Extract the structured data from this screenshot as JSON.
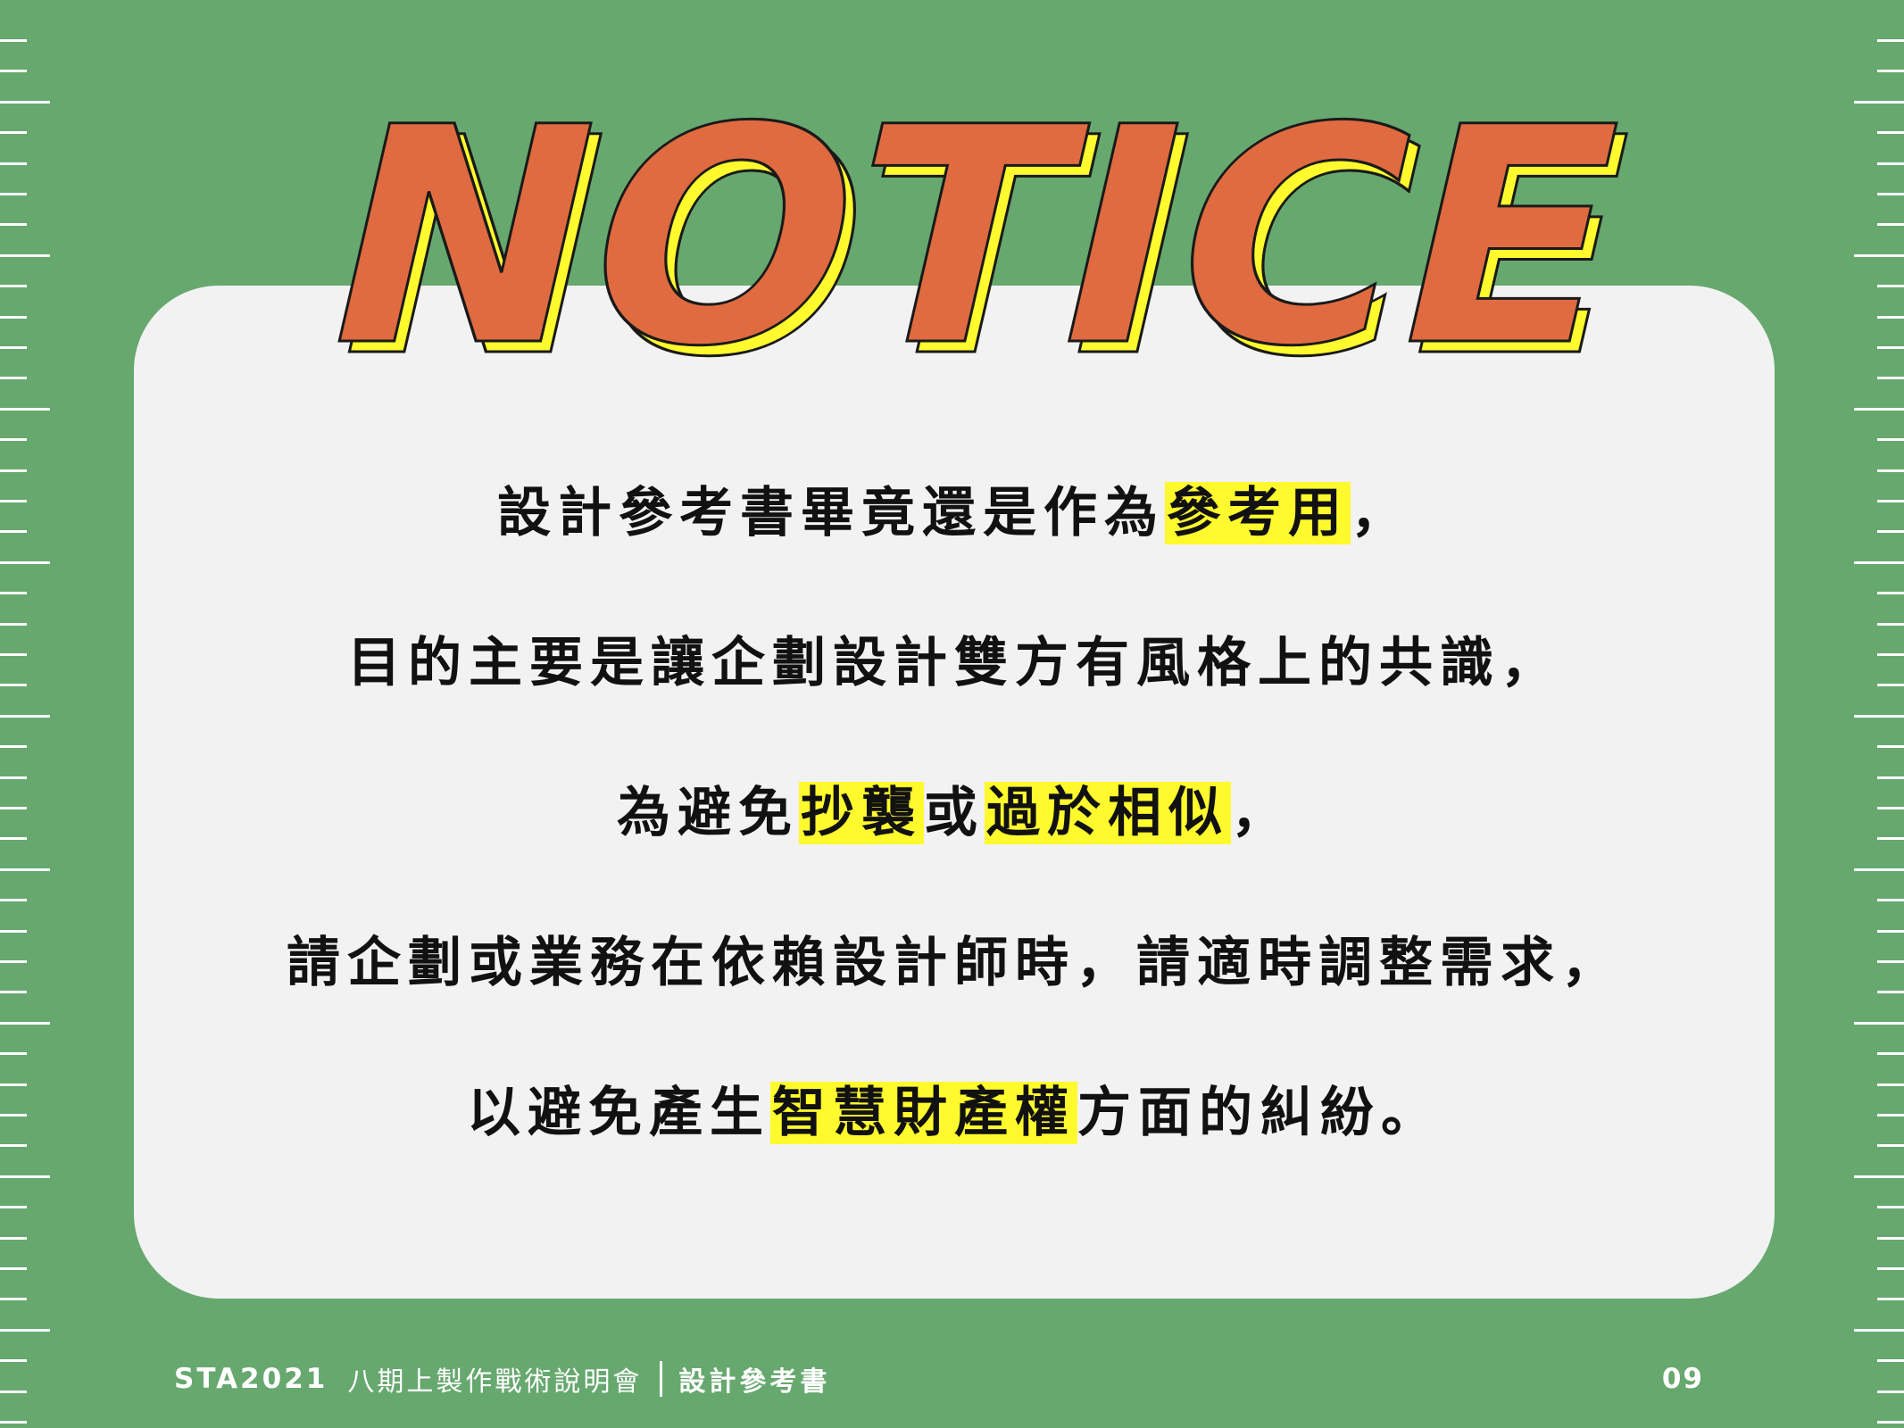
{
  "title": {
    "text": "NOTICE",
    "fill_color": "#e06b40",
    "shadow_color": "#fffa2e",
    "outline_color": "#1a1a1a"
  },
  "message": {
    "lines": [
      [
        {
          "text": "設計參考書畢竟還是作為",
          "highlight": false
        },
        {
          "text": "參考用",
          "highlight": true
        },
        {
          "text": "，",
          "highlight": false
        }
      ],
      [
        {
          "text": "目的主要是讓企劃設計雙方有風格上的共識，",
          "highlight": false
        }
      ],
      [
        {
          "text": "為避免",
          "highlight": false
        },
        {
          "text": "抄襲",
          "highlight": true
        },
        {
          "text": "或",
          "highlight": false
        },
        {
          "text": "過於相似",
          "highlight": true
        },
        {
          "text": "，",
          "highlight": false
        }
      ],
      [
        {
          "text": "請企劃或業務在依賴設計師時，請適時調整需求，",
          "highlight": false
        }
      ],
      [
        {
          "text": "以避免產生",
          "highlight": false
        },
        {
          "text": "智慧財產權",
          "highlight": true
        },
        {
          "text": "方面的糾紛。",
          "highlight": false
        }
      ]
    ]
  },
  "footer": {
    "brand": "STA2021",
    "event": "八期上製作戰術說明會",
    "doc": "設計參考書",
    "page": "09"
  },
  "colors": {
    "background": "#67a86f",
    "card": "#f2f2f2",
    "highlight": "#fffa2e",
    "text": "#111111",
    "footer_text": "#ffffff"
  }
}
